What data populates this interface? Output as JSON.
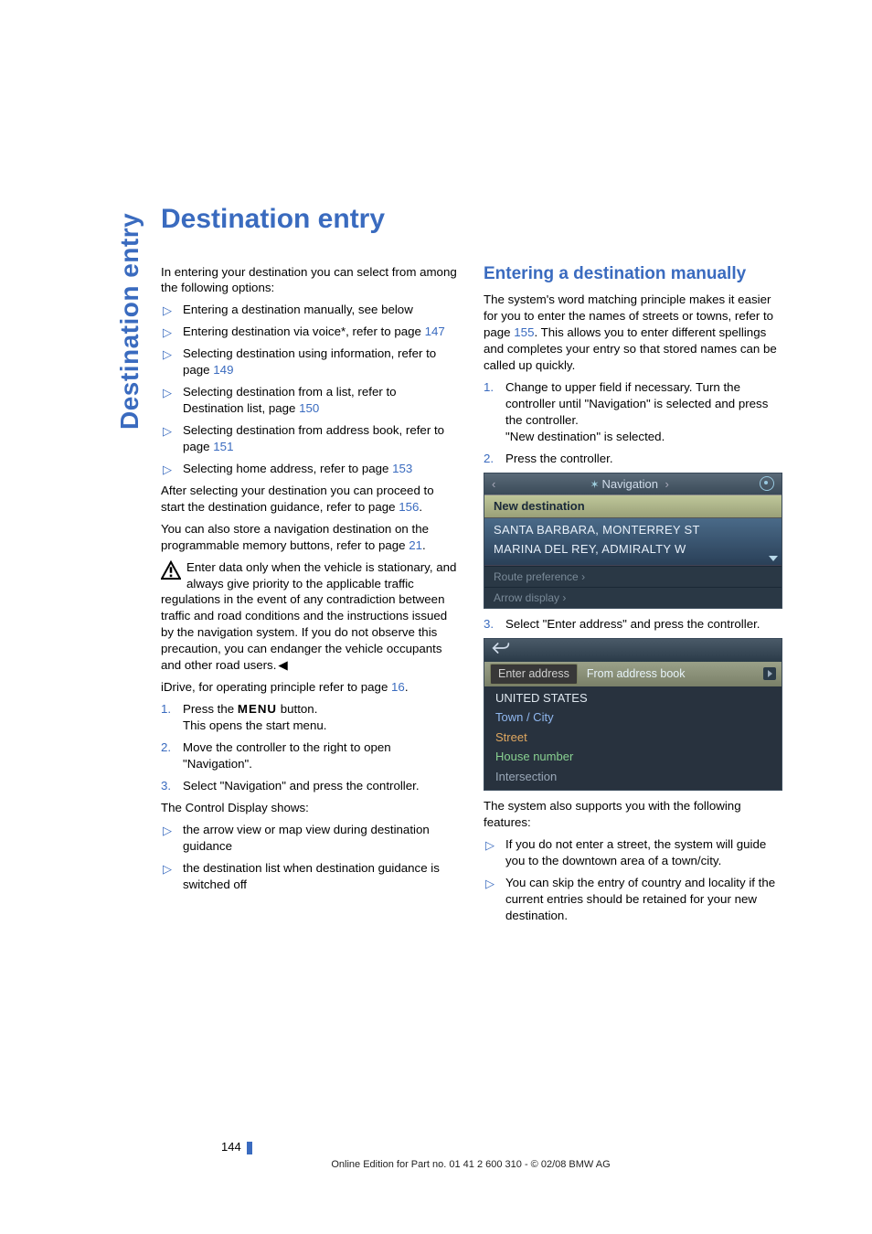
{
  "side_title": "Destination entry",
  "page_title": "Destination entry",
  "left": {
    "intro": "In entering your destination you can select from among the following options:",
    "options": [
      {
        "text": "Entering a destination manually, see below"
      },
      {
        "text": "Entering destination via voice*, refer to page ",
        "link": "147"
      },
      {
        "text": "Selecting destination using information, refer to page ",
        "link": "149"
      },
      {
        "text": "Selecting destination from a list, refer to Destination list, page ",
        "link": "150"
      },
      {
        "text": "Selecting destination from address book, refer to page ",
        "link": "151"
      },
      {
        "text": "Selecting home address, refer to page ",
        "link": "153"
      }
    ],
    "after_select_a": "After selecting your destination you can proceed to start the destination guidance, refer to page ",
    "after_select_link": "156",
    "after_select_b": ".",
    "store_a": "You can also store a navigation destination on the programmable memory buttons, refer to page ",
    "store_link": "21",
    "store_b": ".",
    "warning": "Enter data only when the vehicle is stationary, and always give priority to the applicable traffic regulations in the event of any contradiction between traffic and road conditions and the instructions issued by the navigation system. If you do not observe this precaution, you can endanger the vehicle occupants and other road users.",
    "idrive_a": "iDrive, for operating principle refer to page ",
    "idrive_link": "16",
    "idrive_b": ".",
    "steps": [
      {
        "n": "1.",
        "a": "Press the ",
        "btn": "MENU",
        "b": " button.",
        "sub": "This opens the start menu."
      },
      {
        "n": "2.",
        "a": "Move the controller to the right to open \"Navigation\"."
      },
      {
        "n": "3.",
        "a": "Select \"Navigation\" and press the controller."
      }
    ],
    "cd_shows": "The Control Display shows:",
    "cd_list": [
      "the arrow view or map view during destination guidance",
      "the destination list when destination guidance is switched off"
    ]
  },
  "right": {
    "heading": "Entering a destination manually",
    "p1a": "The system's word matching principle makes it easier for you to enter the names of streets or towns, refer to page ",
    "p1link": "155",
    "p1b": ". This allows you to enter different spellings and completes your entry so that stored names can be called up quickly.",
    "steps12": [
      {
        "n": "1.",
        "a": "Change to upper field if necessary. Turn the controller until \"Navigation\" is selected and press the controller.",
        "sub": "\"New destination\" is selected."
      },
      {
        "n": "2.",
        "a": "Press the controller."
      }
    ],
    "nav1": {
      "title": "Navigation",
      "new_dest": "New destination",
      "line1": "SANTA BARBARA, MONTERREY ST",
      "line2": "MARINA DEL REY, ADMIRALTY W",
      "route_pref": "Route preference ",
      "arrow_disp": "Arrow display "
    },
    "step3": {
      "n": "3.",
      "a": "Select \"Enter address\" and press the controller."
    },
    "nav2": {
      "tab1": "Enter address",
      "tab2": "From address book",
      "us": "UNITED STATES",
      "town": "Town / City",
      "street": "Street",
      "house": "House number",
      "intersection": "Intersection"
    },
    "support": "The system also supports you with the following features:",
    "support_list": [
      "If you do not enter a street, the system will guide you to the downtown area of a town/city.",
      "You can skip the entry of country and locality if the current entries should be retained for your new destination."
    ]
  },
  "footer": {
    "page": "144",
    "edition": "Online Edition for Part no. 01 41 2 600 310 - © 02/08 BMW AG"
  }
}
